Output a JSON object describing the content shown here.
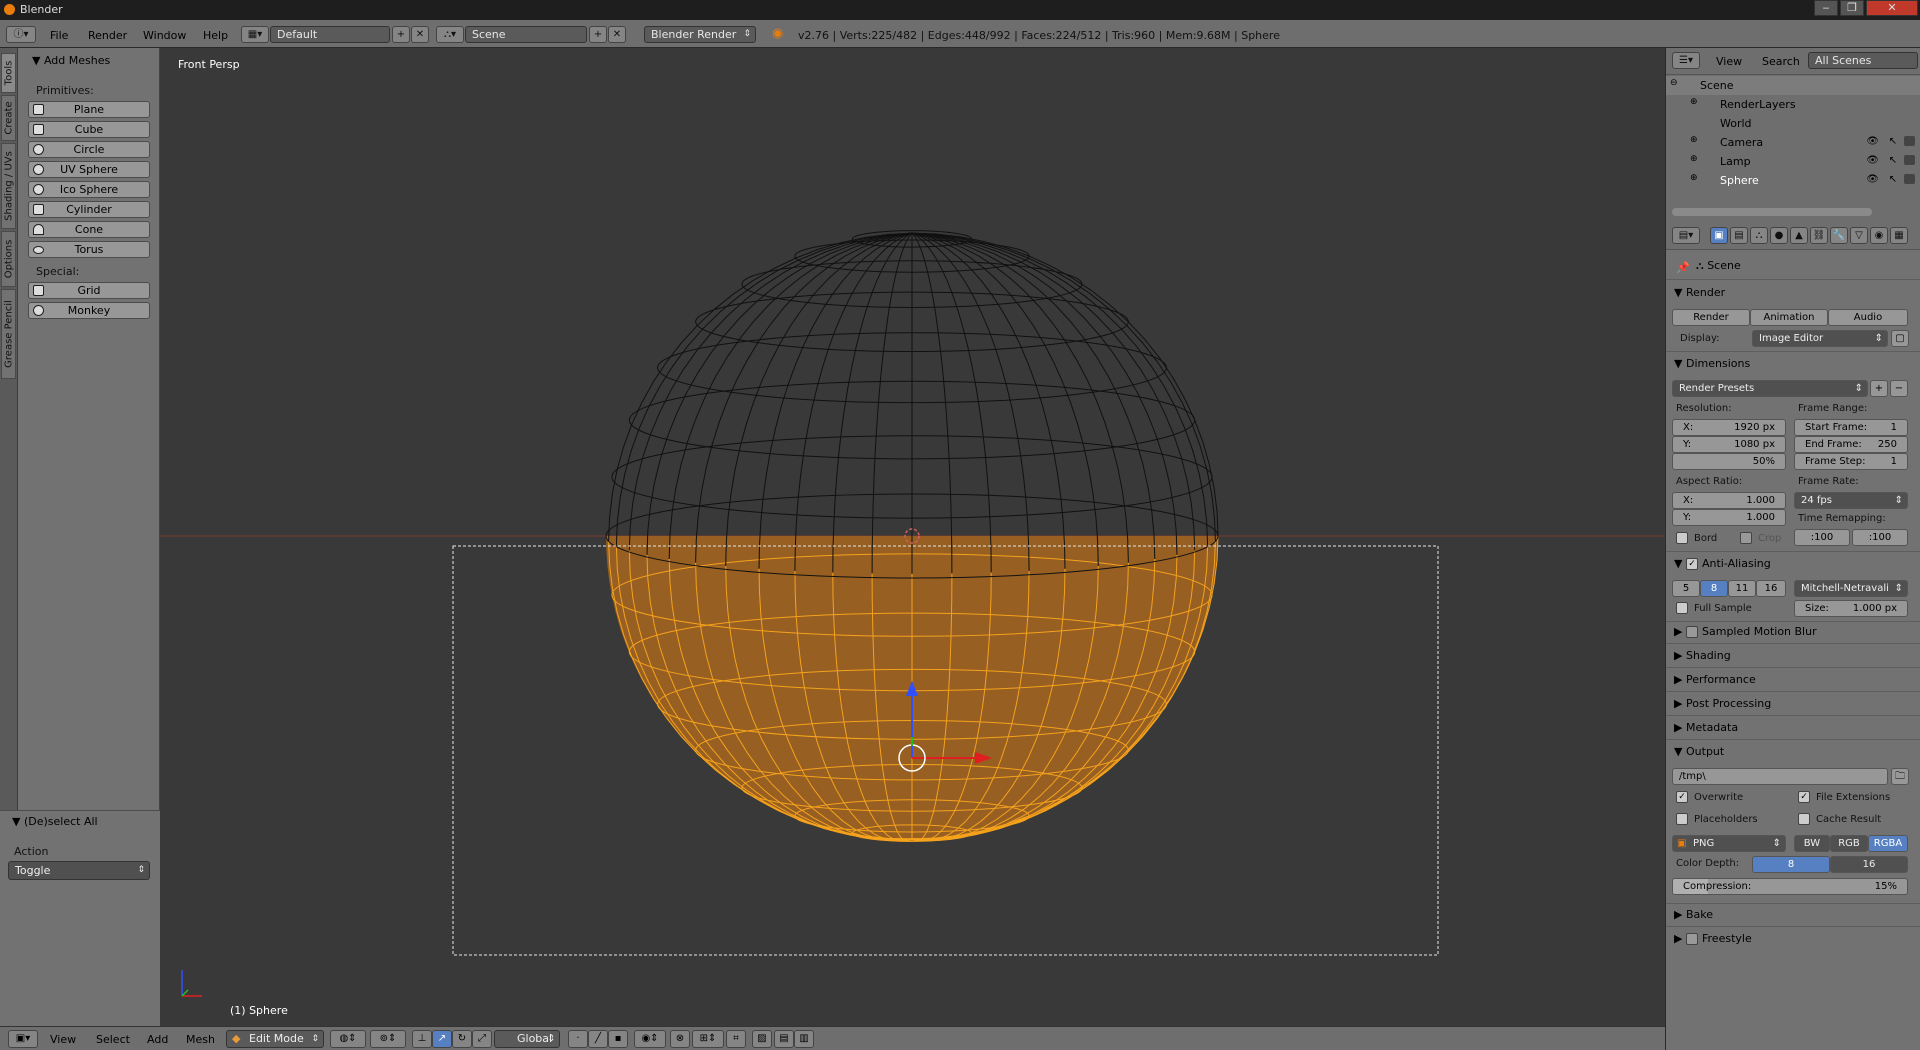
{
  "window": {
    "title": "Blender",
    "controls": [
      "‒",
      "❐",
      "✕"
    ]
  },
  "header": {
    "menus": [
      "File",
      "Render",
      "Window",
      "Help"
    ],
    "layout": "Default",
    "scene": "Scene",
    "engine": "Blender Render",
    "stats": "v2.76 | Verts:225/482 | Edges:448/992 | Faces:224/512 | Tris:960 | Mem:9.68M | Sphere"
  },
  "vtabs": [
    "Tools",
    "Create",
    "Shading / UVs",
    "Options",
    "Grease Pencil"
  ],
  "toolshelf": {
    "panel_title": "Add Meshes",
    "primitives_label": "Primitives:",
    "primitives": [
      "Plane",
      "Cube",
      "Circle",
      "UV Sphere",
      "Ico Sphere",
      "Cylinder",
      "Cone",
      "Torus"
    ],
    "special_label": "Special:",
    "special": [
      "Grid",
      "Monkey"
    ]
  },
  "operator": {
    "title": "(De)select All",
    "action_label": "Action",
    "action_value": "Toggle"
  },
  "viewport": {
    "view_label": "Front Persp",
    "object_label": "(1) Sphere"
  },
  "footer": {
    "menus": [
      "View",
      "Select",
      "Add",
      "Mesh"
    ],
    "mode": "Edit Mode",
    "orientation": "Global"
  },
  "outliner": {
    "menus": [
      "View",
      "Search"
    ],
    "filter": "All Scenes",
    "items": [
      {
        "label": "Scene",
        "color": "#6a8fc8"
      },
      {
        "label": "RenderLayers",
        "color": "#9aa4b0"
      },
      {
        "label": "World",
        "color": "#7fa0c4"
      },
      {
        "label": "Camera",
        "color": "#e0a050"
      },
      {
        "label": "Lamp",
        "color": "#e8d060"
      },
      {
        "label": "Sphere",
        "color": "#e89a3a"
      }
    ]
  },
  "properties": {
    "context": "Scene",
    "render_section": "Render",
    "render_buttons": [
      "Render",
      "Animation",
      "Audio"
    ],
    "display_label": "Display:",
    "display_value": "Image Editor",
    "dimensions_section": "Dimensions",
    "render_presets": "Render Presets",
    "resolution_label": "Resolution:",
    "res_x_key": "X:",
    "res_x": "1920 px",
    "res_y_key": "Y:",
    "res_y": "1080 px",
    "res_pct": "50%",
    "frame_range_label": "Frame Range:",
    "start_key": "Start Frame:",
    "start": "1",
    "end_key": "End Frame:",
    "end": "250",
    "step_key": "Frame Step:",
    "step": "1",
    "aspect_label": "Aspect Ratio:",
    "aspect_x": "1.000",
    "aspect_y": "1.000",
    "frame_rate_label": "Frame Rate:",
    "frame_rate": "24 fps",
    "time_remap_label": "Time Remapping:",
    "remap_old": ":100",
    "remap_new": ":100",
    "bord": "Bord",
    "crop": "Crop",
    "aa_section": "Anti-Aliasing",
    "aa_samples": [
      "5",
      "8",
      "11",
      "16"
    ],
    "aa_filter": "Mitchell-Netravali",
    "full_sample": "Full Sample",
    "size_key": "Size:",
    "size_value": "1.000 px",
    "collapsed_sections": [
      "Sampled Motion Blur",
      "Shading",
      "Performance",
      "Post Processing",
      "Metadata"
    ],
    "output_section": "Output",
    "output_path": "/tmp\\",
    "overwrite": "Overwrite",
    "file_extensions": "File Extensions",
    "placeholders": "Placeholders",
    "cache_result": "Cache Result",
    "format": "PNG",
    "color_modes": [
      "BW",
      "RGB",
      "RGBA"
    ],
    "color_depth_label": "Color Depth:",
    "depths": [
      "8",
      "16"
    ],
    "compression_label": "Compression:",
    "compression_value": "15%",
    "bake_section": "Bake",
    "freestyle_section": "Freestyle"
  },
  "colors": {
    "selection": "#f5a21c",
    "wire": "#111111",
    "accent": "#5680c2"
  }
}
